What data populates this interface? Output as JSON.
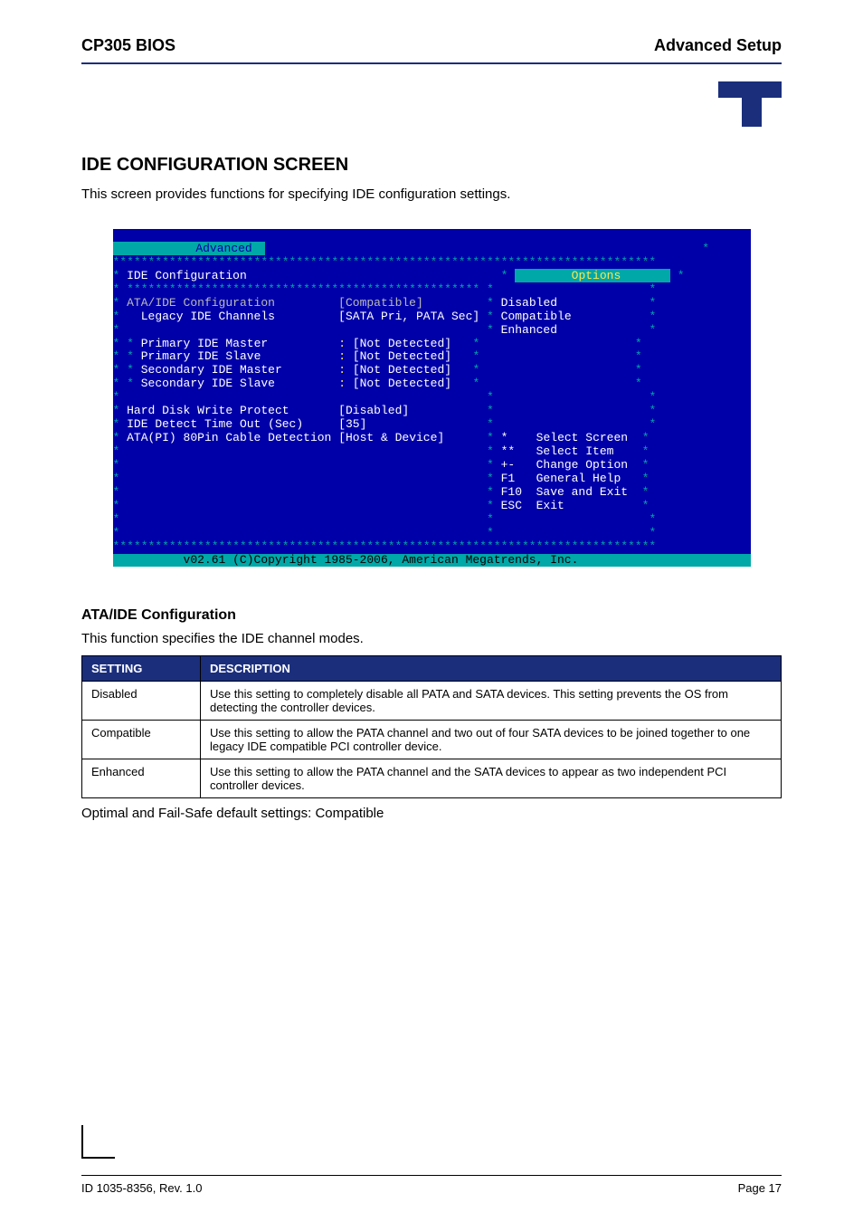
{
  "header": {
    "left": "CP305 BIOS",
    "right": "Advanced Setup"
  },
  "section": {
    "title": "IDE CONFIGURATION SCREEN",
    "intro": "This screen provides functions for specifying IDE configuration settings."
  },
  "bios": {
    "tab": "Advanced",
    "heading": "IDE Configuration",
    "options_label": "Options",
    "item_ata": "ATA/IDE Configuration",
    "val_ata": "[Compatible]",
    "item_legacy": "Legacy IDE Channels",
    "val_legacy": "[SATA Pri, PATA Sec]",
    "dev_pm": "Primary IDE Master",
    "dev_ps": "Primary IDE Slave",
    "dev_sm": "Secondary IDE Master",
    "dev_ss": "Secondary IDE Slave",
    "not_detected": "[Not Detected]",
    "item_hdwp": "Hard Disk Write Protect",
    "val_hdwp": "[Disabled]",
    "item_timeout": "IDE Detect Time Out (Sec)",
    "val_timeout": "[35]",
    "item_cable": "ATA(PI) 80Pin Cable Detection",
    "val_cable": "[Host & Device]",
    "opt_disabled": "Disabled",
    "opt_compatible": "Compatible",
    "opt_enhanced": "Enhanced",
    "hint_screen": "Select Screen",
    "hint_item": "Select Item",
    "hint_change": "Change Option",
    "hint_help": "General Help",
    "hint_save": "Save and Exit",
    "hint_exit": "Exit",
    "key_f1": "F1",
    "key_f10": "F10",
    "key_esc": "ESC",
    "footer": "v02.61 (C)Copyright 1985-2006, American Megatrends, Inc."
  },
  "sub": {
    "title": "ATA/IDE Configuration",
    "desc": "This function specifies the IDE channel modes."
  },
  "table": {
    "h_setting": "SETTING",
    "h_desc": "DESCRIPTION",
    "rows": [
      {
        "setting": "Disabled",
        "desc": "Use this setting to completely disable all PATA and SATA devices. This setting prevents the OS from detecting the controller devices."
      },
      {
        "setting": "Compatible",
        "desc": "Use this setting to allow the PATA channel and two out of four SATA devices to be joined together to one legacy IDE compatible PCI controller device."
      },
      {
        "setting": "Enhanced",
        "desc": "Use this setting to allow the PATA channel and the SATA devices to appear as two independent PCI controller devices."
      }
    ]
  },
  "defaults": "Optimal and Fail-Safe default settings: Compatible",
  "footer": {
    "left": "ID 1035-8356, Rev. 1.0",
    "right": "Page 17"
  }
}
